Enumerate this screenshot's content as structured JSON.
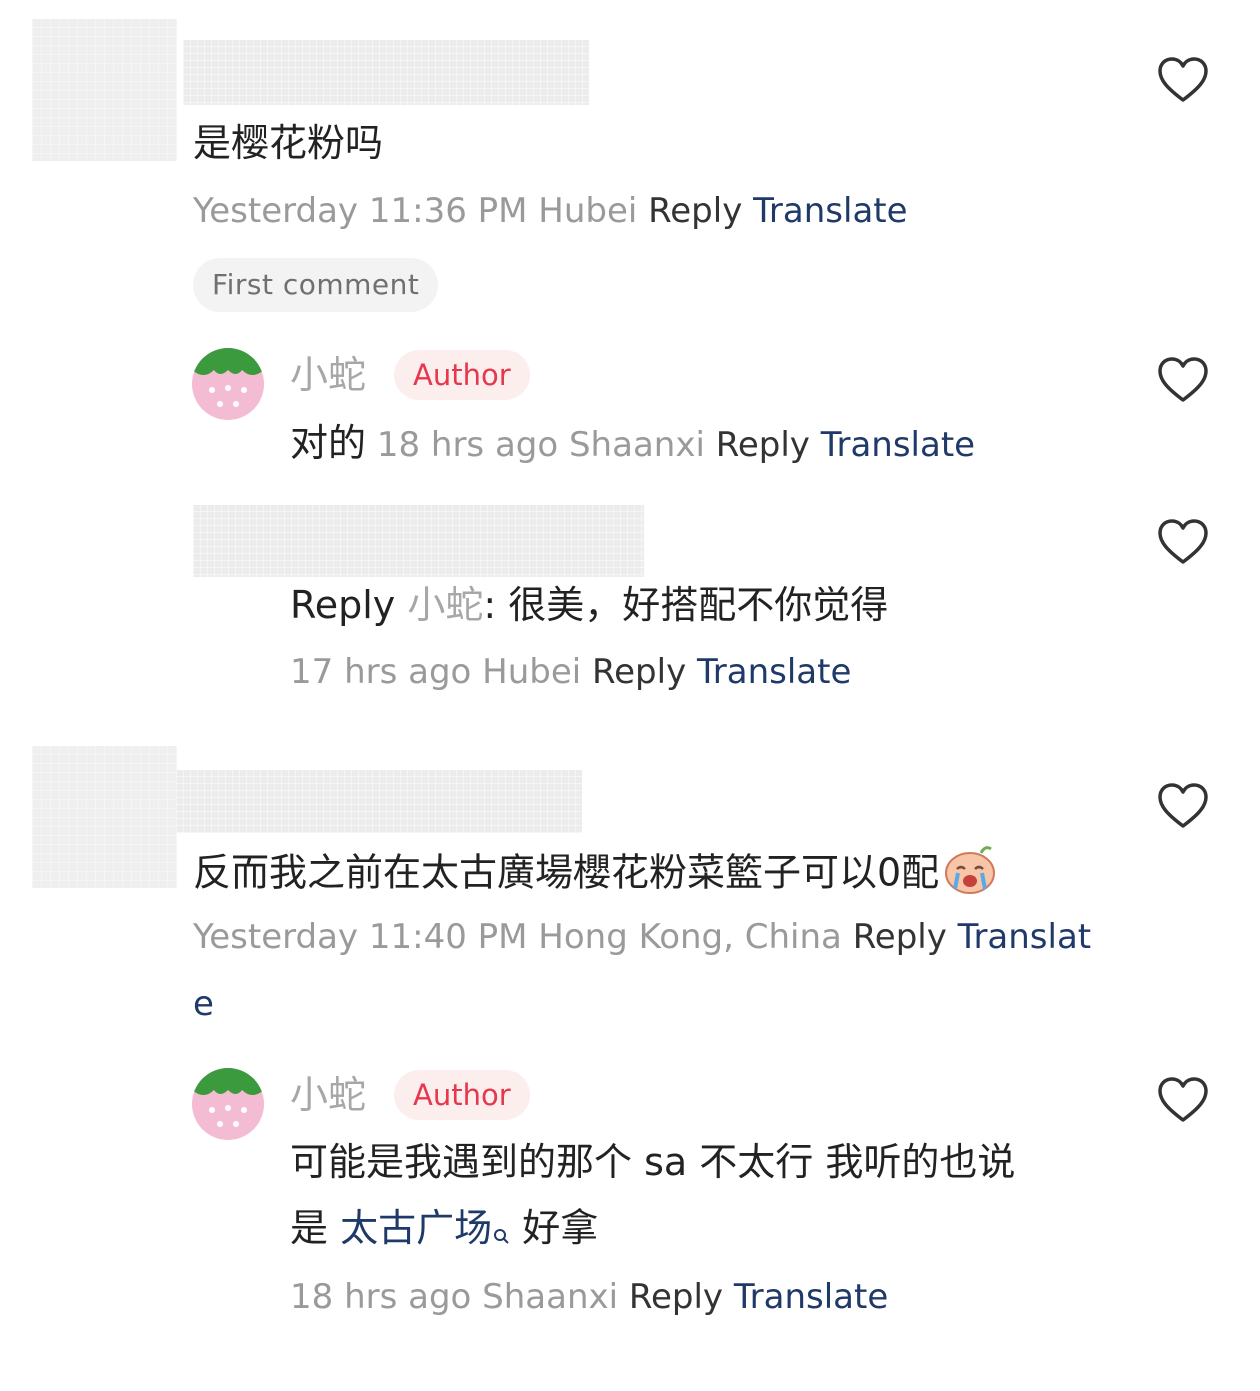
{
  "comments": [
    {
      "text": "是樱花粉吗",
      "meta": "Yesterday 11:36 PM Hubei",
      "reply_label": "Reply",
      "translate_label": "Translate",
      "badge": "First comment",
      "replies": [
        {
          "username": "小蛇",
          "badge": "Author",
          "text": "对的",
          "meta": "18 hrs ago Shaanxi",
          "reply_label": "Reply",
          "translate_label": "Translate"
        },
        {
          "reply_prefix": "Reply",
          "reply_to": "小蛇",
          "text": ": 很美，好搭配不你觉得",
          "meta": "17 hrs ago Hubei",
          "reply_label": "Reply",
          "translate_label": "Translate"
        }
      ]
    },
    {
      "text": "反而我之前在太古廣場櫻花粉菜籃子可以0配",
      "emoji": "crying-face-emoji",
      "meta": "Yesterday 11:40 PM Hong Kong, China",
      "reply_label": "Reply",
      "translate_label_part1": "Translat",
      "translate_label_part2": "e",
      "replies": [
        {
          "username": "小蛇",
          "badge": "Author",
          "text_line1": "可能是我遇到的那个 sa 不太行 我听的也说",
          "text_line2_prefix": "是",
          "search_link": "太古广场",
          "text_line2_suffix": "好拿",
          "meta": "18 hrs ago Shaanxi",
          "reply_label": "Reply",
          "translate_label": "Translate"
        }
      ]
    }
  ],
  "icons": {
    "like": "heart-outline-icon",
    "search": "search-icon"
  },
  "colors": {
    "link_blue": "#1f3a68",
    "author_badge_text": "#e5374d",
    "author_badge_bg": "#fdeeee",
    "meta_gray": "#9a9a9a"
  }
}
